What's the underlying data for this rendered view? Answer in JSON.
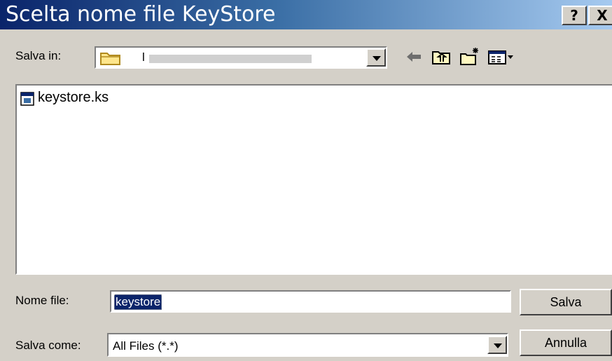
{
  "window": {
    "title": "Scelta nome file KeyStore",
    "help_label": "?",
    "close_label": "X"
  },
  "toolbar": {
    "save_in_label": "Salva in:",
    "location_value": "l",
    "icons": [
      "back-arrow-icon",
      "up-folder-icon",
      "new-folder-icon",
      "view-menu-icon"
    ]
  },
  "files": [
    {
      "name": "keystore.ks",
      "icon": "keystore-file-icon"
    }
  ],
  "form": {
    "filename_label": "Nome file:",
    "filename_value": "keystore",
    "savetype_label": "Salva come:",
    "savetype_value": "All Files (*.*)",
    "save_button": "Salva",
    "cancel_button": "Annulla"
  },
  "colors": {
    "titlebar_start": "#0a246a",
    "titlebar_end": "#a6caf0",
    "window_bg": "#d4d0c8",
    "selection": "#0a246a"
  }
}
